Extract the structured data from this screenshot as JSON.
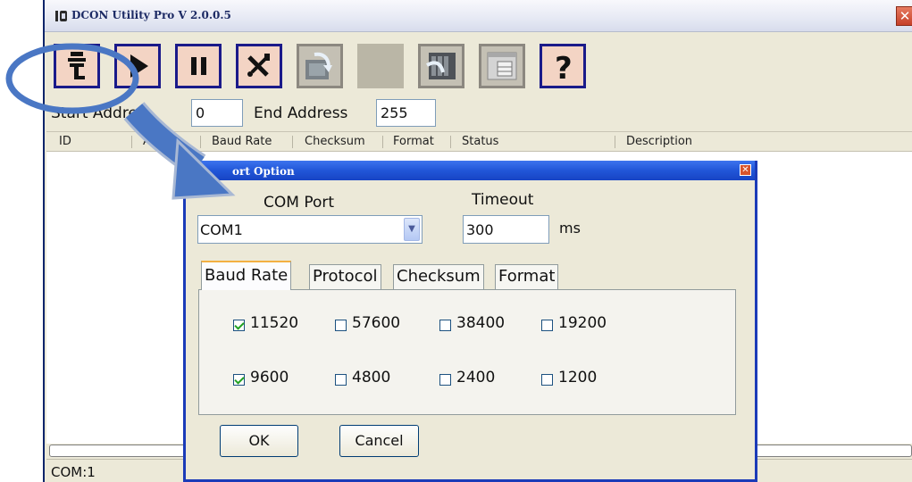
{
  "window": {
    "title": "DCON Utility Pro V 2.0.0.5",
    "close": "✕"
  },
  "toolbar": {
    "buttons": [
      {
        "icon": "com-port-icon"
      },
      {
        "icon": "play-icon"
      },
      {
        "icon": "pause-icon"
      },
      {
        "icon": "tools-icon"
      },
      {
        "icon": "module-search-icon"
      },
      {
        "icon": "blank"
      },
      {
        "icon": "rack-search-icon"
      },
      {
        "icon": "config-window-icon"
      },
      {
        "icon": "help-icon"
      }
    ]
  },
  "address": {
    "start_label": "Start Addre",
    "start_value": "0",
    "end_label": "End Address",
    "end_value": "255"
  },
  "list": {
    "columns": [
      "ID",
      "Add",
      "Baud Rate",
      "Checksum",
      "Format",
      "Status",
      "Description"
    ]
  },
  "status_bar": {
    "text": "COM:1"
  },
  "dialog": {
    "title": "ort Option",
    "close": "✕",
    "com_port_label": "COM Port",
    "com_port_value": "COM1",
    "timeout_label": "Timeout",
    "timeout_value": "300",
    "timeout_unit": "ms",
    "tabs": [
      "Baud Rate",
      "Protocol",
      "Checksum",
      "Format"
    ],
    "active_tab": "Baud Rate",
    "baud_rates": [
      {
        "label": "11520",
        "checked": true
      },
      {
        "label": "57600",
        "checked": false
      },
      {
        "label": "38400",
        "checked": false
      },
      {
        "label": "19200",
        "checked": false
      },
      {
        "label": "9600",
        "checked": true
      },
      {
        "label": "4800",
        "checked": false
      },
      {
        "label": "2400",
        "checked": false
      },
      {
        "label": "1200",
        "checked": false
      }
    ],
    "ok_label": "OK",
    "cancel_label": "Cancel"
  },
  "annotations": {
    "highlight_color": "#4a77c4",
    "arrow_color": "#4a77c4"
  }
}
